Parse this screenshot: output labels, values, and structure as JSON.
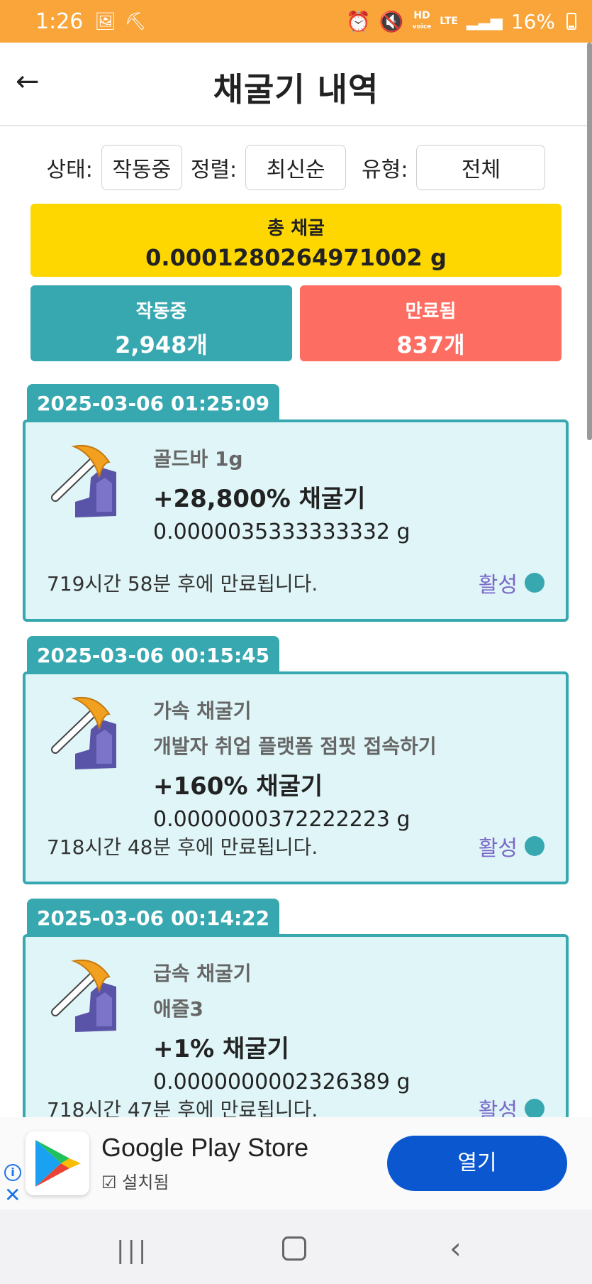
{
  "status_bar": {
    "time": "1:26",
    "network_hd": "HD",
    "network_hd_sub": "voice",
    "network_lte": "LTE",
    "battery": "16%"
  },
  "header": {
    "back": "←",
    "title": "채굴기 내역"
  },
  "filters": {
    "status_label": "상태:",
    "status_value": "작동중",
    "sort_label": "정렬:",
    "sort_value": "최신순",
    "type_label": "유형:",
    "type_value": "전체"
  },
  "summary": {
    "total_label": "총 채굴",
    "total_value": "0.0001280264971002 g",
    "active_label": "작동중",
    "active_value": "2,948개",
    "expired_label": "만료됨",
    "expired_value": "837개",
    "colors": {
      "total": "#ffd700",
      "active": "#38a8b0",
      "expired": "#fd6d62"
    }
  },
  "miners": [
    {
      "date": "2025-03-06 01:25:09",
      "name": "골드바 1g",
      "rate": "+28,800% 채굴기",
      "amount": "0.0000035333333332 g",
      "expire": "719시간 58분 후에 만료됩니다.",
      "status": "활성"
    },
    {
      "date": "2025-03-06 00:15:45",
      "name": "가속 채굴기",
      "subtitle": "개발자 취업 플랫폼 점핏 접속하기",
      "rate": "+160% 채굴기",
      "amount": "0.0000000372222223 g",
      "expire": "718시간 48분 후에 만료됩니다.",
      "status": "활성"
    },
    {
      "date": "2025-03-06 00:14:22",
      "name": "급속 채굴기",
      "subtitle": "애즐3",
      "rate": "+1% 채굴기",
      "amount": "0.0000000002326389 g",
      "expire": "718시간 47분 후에 만료됩니다.",
      "status": "활성"
    }
  ],
  "ad": {
    "title": "Google Play Store",
    "subtitle": "설치됨",
    "button": "열기",
    "info": "i",
    "close": "✕"
  },
  "navbar": {
    "recent": "|||",
    "back": "‹"
  }
}
